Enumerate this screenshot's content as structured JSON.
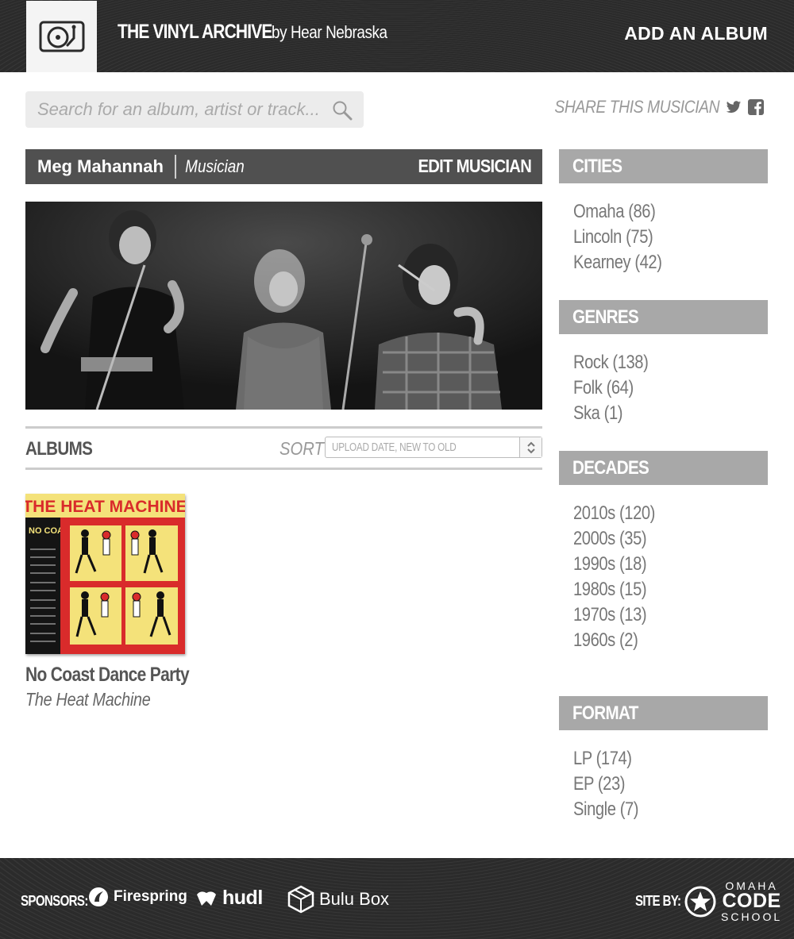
{
  "header": {
    "site_title": "THE VINYL ARCHIVE",
    "site_subtitle": "by Hear Nebraska",
    "add_album": "ADD AN ALBUM"
  },
  "search": {
    "placeholder": "Search for an album, artist or track..."
  },
  "share": {
    "label": "SHARE THIS MUSICIAN",
    "icons": [
      "twitter-icon",
      "facebook-icon"
    ]
  },
  "musician": {
    "name": "Meg Mahannah",
    "role": "Musician",
    "edit_label": "EDIT MUSICIAN"
  },
  "albums_section": {
    "title": "ALBUMS",
    "sort_label": "SORT",
    "sort_value": "UPLOAD DATE, NEW TO OLD"
  },
  "albums": [
    {
      "title": "No Coast Dance Party",
      "artist": "The Heat Machine",
      "cover_band_text": "THE HEAT MACHINE",
      "cover_album_text": "NO COAST DANCE PARTY"
    }
  ],
  "sidebar": {
    "cities": {
      "heading": "CITIES",
      "items": [
        "Omaha (86)",
        "Lincoln (75)",
        "Kearney (42)"
      ]
    },
    "genres": {
      "heading": "GENRES",
      "items": [
        "Rock (138)",
        "Folk (64)",
        "Ska (1)"
      ]
    },
    "decades": {
      "heading": "DECADES",
      "items": [
        "2010s (120)",
        "2000s (35)",
        "1990s (18)",
        "1980s (15)",
        "1970s (13)",
        "1960s (2)"
      ]
    },
    "format": {
      "heading": "FORMAT",
      "items": [
        "LP (174)",
        "EP (23)",
        "Single (7)"
      ]
    }
  },
  "footer": {
    "sponsors_label": "SPONSORS:",
    "sponsors": [
      "Firespring",
      "hudl",
      "Bulu Box"
    ],
    "site_by_label": "SITE BY:",
    "site_by": {
      "top": "OMAHA",
      "middle": "CODE",
      "bottom": "SCHOOL"
    }
  },
  "colors": {
    "header_bg": "#2e2e2e",
    "musician_bar": "#505050",
    "facet_header": "#a8a8a8",
    "cover_red": "#d92b2b",
    "cover_yellow": "#f4e27a"
  }
}
